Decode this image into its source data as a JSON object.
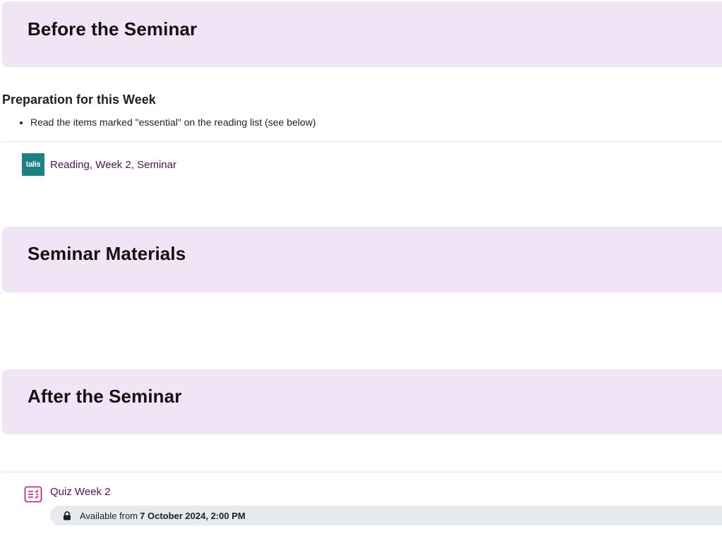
{
  "sections": {
    "before": {
      "title": "Before the Seminar"
    },
    "materials": {
      "title": "Seminar Materials"
    },
    "after": {
      "title": "After the Seminar"
    }
  },
  "preparation": {
    "heading": "Preparation for this Week",
    "items": [
      "Read the items marked \"essential\" on the reading list (see below)"
    ]
  },
  "reading_activity": {
    "icon": "talis-icon",
    "icon_text": "talis",
    "icon_color": "#1b8185",
    "label": "Reading, Week 2, Seminar"
  },
  "quiz_activity": {
    "icon": "quiz-icon",
    "icon_color": "#c4137f",
    "label": "Quiz Week 2",
    "availability_prefix": "Available from",
    "availability_date": "7 October 2024, 2:00 PM",
    "lock_icon": "lock-icon"
  },
  "colors": {
    "banner_bg": "#f2e4f7",
    "link": "#4a1450",
    "availability_bg": "#e7eaee"
  }
}
